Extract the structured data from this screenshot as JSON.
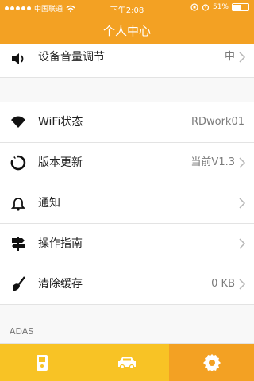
{
  "status_bar": {
    "carrier": "中国联通",
    "time": "下午2:08",
    "battery": "51%",
    "battery_level": 0.51
  },
  "header": {
    "title": "个人中心"
  },
  "items": [
    {
      "label": "设备音量调节",
      "value": "中",
      "icon": "volume-icon"
    },
    {
      "label": "WiFi状态",
      "value": "RDwork01",
      "icon": "wifi-icon"
    },
    {
      "label": "版本更新",
      "value": "当前V1.3",
      "icon": "update-icon"
    },
    {
      "label": "通知",
      "value": "",
      "icon": "bell-icon"
    },
    {
      "label": "操作指南",
      "value": "",
      "icon": "signpost-icon"
    },
    {
      "label": "清除缓存",
      "value": "0 KB",
      "icon": "brush-icon"
    }
  ],
  "section": {
    "label": "ADAS"
  },
  "tabbar": {
    "tabs": [
      {
        "icon": "device-icon",
        "active": false
      },
      {
        "icon": "car-icon",
        "active": false
      },
      {
        "icon": "gear-icon",
        "active": true
      }
    ]
  },
  "colors": {
    "accent": "#f3a123",
    "tabbar": "#f8c325"
  }
}
